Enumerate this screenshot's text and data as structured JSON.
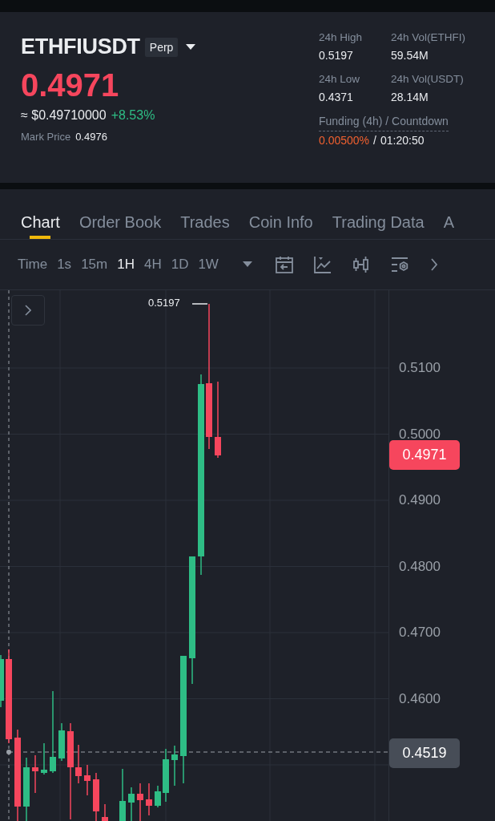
{
  "header": {
    "symbol": "ETHFIUSDT",
    "contract_badge": "Perp",
    "price": "0.4971",
    "usd_price": "≈ $0.49710000",
    "change": "+8.53%",
    "mark_price_label": "Mark Price",
    "mark_price": "0.4976",
    "stats": [
      {
        "label": "24h High",
        "value": "0.5197"
      },
      {
        "label": "24h Vol(ETHFI)",
        "value": "59.54M"
      },
      {
        "label": "24h Low",
        "value": "0.4371"
      },
      {
        "label": "24h Vol(USDT)",
        "value": "28.14M"
      }
    ],
    "funding": {
      "label": "Funding (4h) / Countdown",
      "rate": "0.00500%",
      "separator": "/",
      "countdown": "01:20:50"
    }
  },
  "tabs": [
    {
      "label": "Chart",
      "selected": true
    },
    {
      "label": "Order Book",
      "selected": false
    },
    {
      "label": "Trades",
      "selected": false
    },
    {
      "label": "Coin Info",
      "selected": false
    },
    {
      "label": "Trading Data",
      "selected": false
    },
    {
      "label": "A",
      "selected": false
    }
  ],
  "intervals": [
    {
      "label": "Time",
      "selected": false
    },
    {
      "label": "1s",
      "selected": false
    },
    {
      "label": "15m",
      "selected": false
    },
    {
      "label": "1H",
      "selected": true
    },
    {
      "label": "4H",
      "selected": false
    },
    {
      "label": "1D",
      "selected": false
    },
    {
      "label": "1W",
      "selected": false
    }
  ],
  "chart": {
    "price_axis": [
      "0.5100",
      "0.5000",
      "0.4900",
      "0.4800",
      "0.4700",
      "0.4600"
    ],
    "high_marker": "0.5197",
    "last_price_tag": "0.4971",
    "crosshair_price_tag": "0.4519"
  }
}
